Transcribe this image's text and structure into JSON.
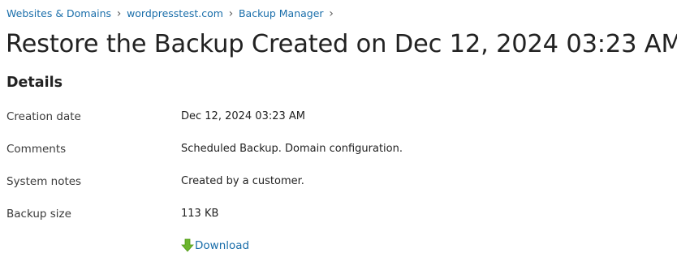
{
  "breadcrumb": {
    "items": [
      {
        "label": "Websites & Domains"
      },
      {
        "label": "wordpresstest.com"
      },
      {
        "label": "Backup Manager"
      }
    ],
    "separator": "›"
  },
  "page": {
    "title": "Restore the Backup Created on Dec 12, 2024 03:23 AM"
  },
  "details": {
    "heading": "Details",
    "rows": [
      {
        "label": "Creation date",
        "value": "Dec 12, 2024 03:23 AM"
      },
      {
        "label": "Comments",
        "value": "Scheduled Backup. Domain configuration."
      },
      {
        "label": "System notes",
        "value": "Created by a customer."
      },
      {
        "label": "Backup size",
        "value": "113 KB"
      }
    ],
    "download_label": "Download",
    "download_icon": "download-arrow-icon"
  },
  "colors": {
    "link": "#1a6eaa",
    "download_icon": "#6cb52d",
    "text": "#222222"
  }
}
